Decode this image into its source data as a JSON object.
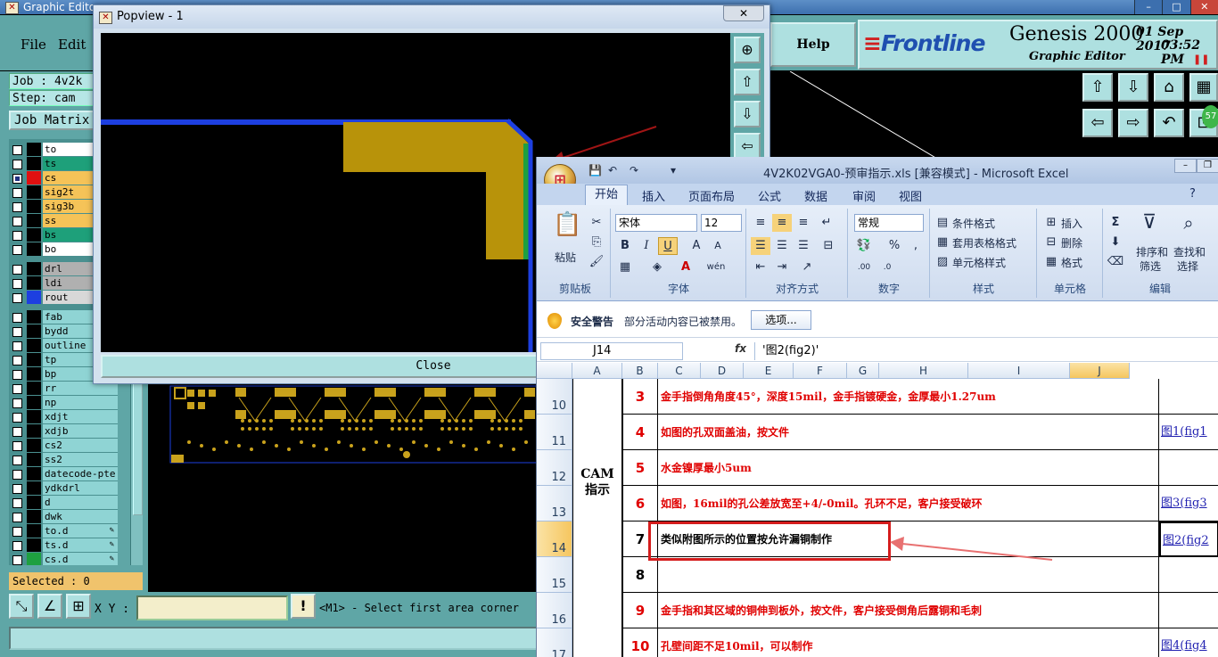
{
  "genesis": {
    "title": "Graphic Edito",
    "menu": [
      "File",
      "Edit"
    ],
    "help_label": "Help",
    "brand": {
      "logo_text": "Frontline",
      "product": "Genesis 2000",
      "subtitle": "Graphic Editor",
      "date": "01 Sep 2017",
      "time": "03:52 PM",
      "pause_icon": "pause-icon"
    },
    "job_label": "Job : 4v2k",
    "step_label": "Step: cam",
    "job_matrix_label": "Job Matrix",
    "layers": [
      {
        "name": "to",
        "color": "#ffffff",
        "name_bg": "#ffffff",
        "swatch": "#000000",
        "checked": false
      },
      {
        "name": "ts",
        "color": "#000000",
        "name_bg": "#1ea07a",
        "swatch": "#000000",
        "checked": false
      },
      {
        "name": "cs",
        "color": "#000000",
        "name_bg": "#f5c358",
        "swatch": "#e01010",
        "checked": true
      },
      {
        "name": "sig2t",
        "color": "#000000",
        "name_bg": "#f5c358",
        "swatch": "#000000",
        "checked": false
      },
      {
        "name": "sig3b",
        "color": "#000000",
        "name_bg": "#f5c358",
        "swatch": "#000000",
        "checked": false
      },
      {
        "name": "ss",
        "color": "#000000",
        "name_bg": "#f5c358",
        "swatch": "#000000",
        "checked": false
      },
      {
        "name": "bs",
        "color": "#000000",
        "name_bg": "#1ea07a",
        "swatch": "#000000",
        "checked": false
      },
      {
        "name": "bo",
        "color": "#000000",
        "name_bg": "#ffffff",
        "swatch": "#000000",
        "checked": false
      },
      {
        "name": "drl",
        "color": "#000000",
        "name_bg": "#b0b0b0",
        "swatch": "#000000",
        "checked": false
      },
      {
        "name": "ldi",
        "color": "#000000",
        "name_bg": "#b0b0b0",
        "swatch": "#000000",
        "checked": false
      },
      {
        "name": "rout",
        "color": "#000000",
        "name_bg": "#d8d8d8",
        "swatch": "#1d3fe0",
        "checked": false
      },
      {
        "name": "fab",
        "color": "#000000",
        "name_bg": "#8fd4d4",
        "swatch": "#000000",
        "checked": false
      },
      {
        "name": "bydd",
        "color": "#000000",
        "name_bg": "#8fd4d4",
        "swatch": "#000000",
        "checked": false
      },
      {
        "name": "outline",
        "color": "#000000",
        "name_bg": "#8fd4d4",
        "swatch": "#000000",
        "checked": false
      },
      {
        "name": "tp",
        "color": "#000000",
        "name_bg": "#8fd4d4",
        "swatch": "#000000",
        "checked": false
      },
      {
        "name": "bp",
        "color": "#000000",
        "name_bg": "#8fd4d4",
        "swatch": "#000000",
        "checked": false
      },
      {
        "name": "rr",
        "color": "#000000",
        "name_bg": "#8fd4d4",
        "swatch": "#000000",
        "checked": false
      },
      {
        "name": "np",
        "color": "#000000",
        "name_bg": "#8fd4d4",
        "swatch": "#000000",
        "checked": false
      },
      {
        "name": "xdjt",
        "color": "#000000",
        "name_bg": "#8fd4d4",
        "swatch": "#000000",
        "checked": false
      },
      {
        "name": "xdjb",
        "color": "#000000",
        "name_bg": "#8fd4d4",
        "swatch": "#000000",
        "checked": false
      },
      {
        "name": "cs2",
        "color": "#000000",
        "name_bg": "#8fd4d4",
        "swatch": "#000000",
        "checked": false
      },
      {
        "name": "ss2",
        "color": "#000000",
        "name_bg": "#8fd4d4",
        "swatch": "#000000",
        "checked": false
      },
      {
        "name": "datecode-pte",
        "color": "#000000",
        "name_bg": "#8fd4d4",
        "swatch": "#000000",
        "checked": false
      },
      {
        "name": "ydkdrl",
        "color": "#000000",
        "name_bg": "#8fd4d4",
        "swatch": "#000000",
        "checked": false
      },
      {
        "name": "d",
        "color": "#000000",
        "name_bg": "#8fd4d4",
        "swatch": "#000000",
        "checked": false
      },
      {
        "name": "dwk",
        "color": "#000000",
        "name_bg": "#8fd4d4",
        "swatch": "#000000",
        "checked": false
      },
      {
        "name": "to.d",
        "color": "#000000",
        "name_bg": "#8fd4d4",
        "swatch": "#000000",
        "checked": false,
        "locked": true
      },
      {
        "name": "ts.d",
        "color": "#000000",
        "name_bg": "#8fd4d4",
        "swatch": "#000000",
        "checked": false,
        "locked": true
      },
      {
        "name": "cs.d",
        "color": "#000000",
        "name_bg": "#8fd4d4",
        "swatch": "#1ea040",
        "checked": false,
        "locked": true
      }
    ],
    "selected_label": "Selected : 0",
    "xy_label": "X Y :",
    "xy_value": "",
    "status_message": "<M1> - Select first area corner",
    "bang_label": "!"
  },
  "popview": {
    "title": "Popview - 1",
    "close_x": "✕",
    "close_label": "Close"
  },
  "excel": {
    "title": "4V2K02VGA0-预审指示.xls [兼容模式] - Microsoft Excel",
    "office_glyph": "⊞",
    "tabs": [
      "开始",
      "插入",
      "页面布局",
      "公式",
      "数据",
      "审阅",
      "视图"
    ],
    "ribbon": {
      "clipboard": {
        "label": "剪贴板",
        "paste": "粘贴"
      },
      "font": {
        "label": "字体",
        "name": "宋体",
        "size": "12",
        "bold": "B",
        "italic": "I",
        "underline": "U"
      },
      "align": {
        "label": "对齐方式"
      },
      "number": {
        "label": "数字",
        "format": "常规",
        "percent": "%"
      },
      "styles": {
        "label": "样式",
        "items": [
          "条件格式",
          "套用表格格式",
          "单元格样式"
        ]
      },
      "cells": {
        "label": "单元格",
        "items": [
          "插入",
          "删除",
          "格式"
        ]
      },
      "editing": {
        "label": "编辑",
        "sort": "排序和",
        "sort2": "筛选",
        "find": "查找和",
        "find2": "选择",
        "sigma": "Σ"
      }
    },
    "security": {
      "title": "安全警告",
      "message": "部分活动内容已被禁用。",
      "button": "选项..."
    },
    "name_box": "J14",
    "fx": "fx",
    "formula": "'图2(fig2)'",
    "columns": [
      {
        "label": "A"
      },
      {
        "label": "B"
      },
      {
        "label": "C"
      },
      {
        "label": "D"
      },
      {
        "label": "E"
      },
      {
        "label": "F"
      },
      {
        "label": "G"
      },
      {
        "label": "H"
      },
      {
        "label": "I"
      },
      {
        "label": "J"
      }
    ],
    "section_label": "CAM指示",
    "section_label_1": "CAM",
    "section_label_2": "指示",
    "rows": [
      {
        "row": "10",
        "num": "3",
        "text": "金手指倒角角度45°，深度15mil，金手指镀硬金，金厚最小1.27um",
        "red": true,
        "link": ""
      },
      {
        "row": "11",
        "num": "4",
        "text": "如图的孔双面盖油，按文件",
        "red": true,
        "link": "图1(fig1"
      },
      {
        "row": "12",
        "num": "5",
        "text": "水金镍厚最小5um",
        "red": true,
        "link": ""
      },
      {
        "row": "13",
        "num": "6",
        "text": "如图，16mil的孔公差放宽至+4/-0mil。孔环不足，客户接受破环",
        "red": true,
        "link": "图3(fig3"
      },
      {
        "row": "14",
        "num": "7",
        "text": "类似附图所示的位置按允许漏铜制作",
        "red": false,
        "link": "图2(fig2"
      },
      {
        "row": "15",
        "num": "8",
        "text": "",
        "red": false,
        "link": ""
      },
      {
        "row": "16",
        "num": "9",
        "text": "金手指和其区域的铜伸到板外，按文件，客户接受倒角后露铜和毛刺",
        "red": true,
        "link": ""
      },
      {
        "row": "17",
        "num": "10",
        "text": "孔壁间距不足10mil，可以制作",
        "red": true,
        "link": "图4(fig4"
      }
    ]
  }
}
